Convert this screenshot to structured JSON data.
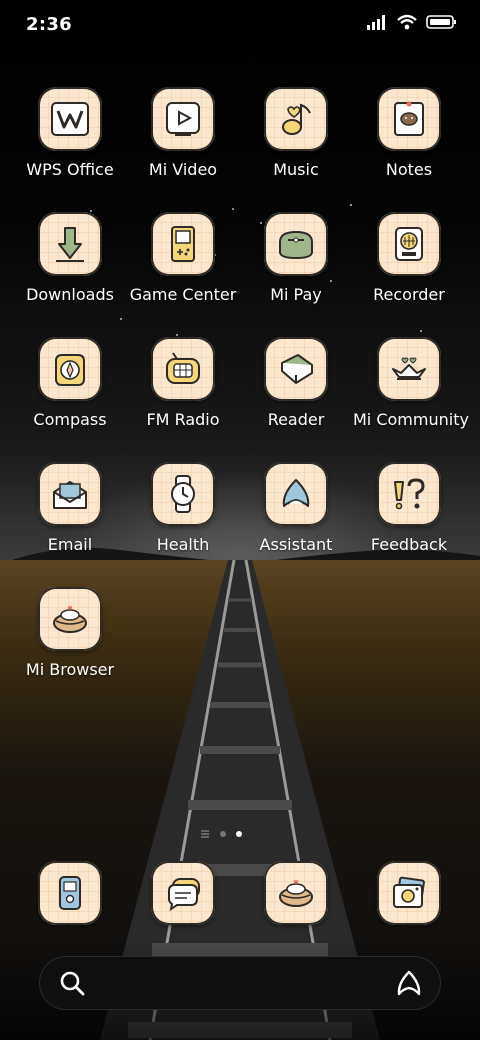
{
  "status": {
    "time": "2:36"
  },
  "apps": [
    {
      "label": "WPS Office",
      "icon": "wps-office-icon"
    },
    {
      "label": "Mi Video",
      "icon": "mi-video-icon"
    },
    {
      "label": "Music",
      "icon": "music-icon"
    },
    {
      "label": "Notes",
      "icon": "notes-icon"
    },
    {
      "label": "Downloads",
      "icon": "downloads-icon"
    },
    {
      "label": "Game Center",
      "icon": "game-center-icon"
    },
    {
      "label": "Mi Pay",
      "icon": "mi-pay-icon"
    },
    {
      "label": "Recorder",
      "icon": "recorder-icon"
    },
    {
      "label": "Compass",
      "icon": "compass-icon"
    },
    {
      "label": "FM Radio",
      "icon": "fm-radio-icon"
    },
    {
      "label": "Reader",
      "icon": "reader-icon"
    },
    {
      "label": "Mi Community",
      "icon": "mi-community-icon"
    },
    {
      "label": "Email",
      "icon": "email-icon"
    },
    {
      "label": "Health",
      "icon": "health-icon"
    },
    {
      "label": "Assistant",
      "icon": "assistant-icon"
    },
    {
      "label": "Feedback",
      "icon": "feedback-icon"
    },
    {
      "label": "Mi Browser",
      "icon": "mi-browser-icon"
    }
  ],
  "dock": [
    {
      "icon": "phone-icon"
    },
    {
      "icon": "messages-icon"
    },
    {
      "icon": "browser-icon"
    },
    {
      "icon": "camera-icon"
    }
  ],
  "pages": {
    "count": 2,
    "current": 2
  },
  "search": {
    "icon": "search-icon",
    "assistant_icon": "assistant-icon"
  },
  "colors": {
    "tile": "#fbe7cd",
    "tile_outline": "#2d2a27",
    "accent_yellow": "#f5d77a",
    "accent_green": "#9fb58a",
    "accent_blue": "#9fc7de"
  }
}
